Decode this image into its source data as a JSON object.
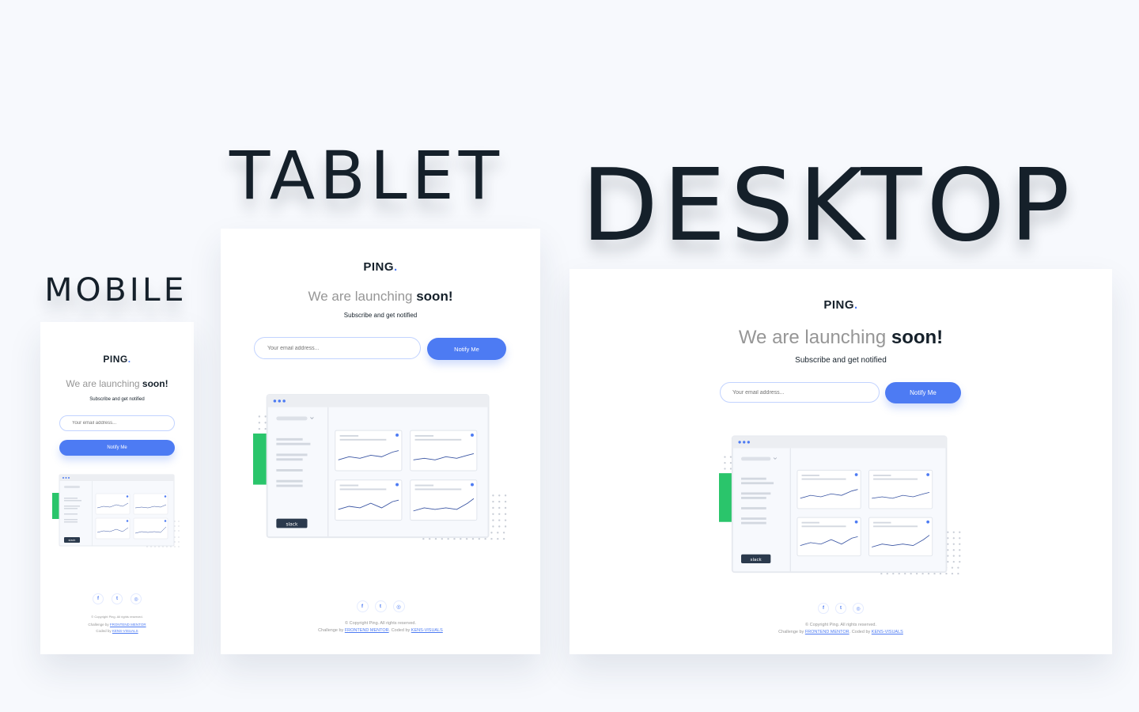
{
  "labels": {
    "mobile": "MOBILE",
    "tablet": "TABLET",
    "desktop": "DESKTOP"
  },
  "brand": {
    "logo": "PING",
    "logo_dot": "."
  },
  "hero": {
    "headline_prefix": "We are launching ",
    "headline_bold": "soon!",
    "subtitle": "Subscribe and get notified"
  },
  "form": {
    "email_placeholder": "Your email address...",
    "button_label": "Notify Me"
  },
  "illustration": {
    "slack_label": "slack"
  },
  "social": [
    {
      "name": "facebook-icon",
      "glyph": "f"
    },
    {
      "name": "twitter-icon",
      "glyph": "t"
    },
    {
      "name": "instagram-icon",
      "glyph": "◎"
    }
  ],
  "footer": {
    "copyright": "© Copyright Ping. All rights reserved.",
    "challenge_prefix": "Challenge by ",
    "challenge_link": "FRONTEND MENTOR",
    "coded_prefix": "Coded by ",
    "coded_link": "KENS-VISUALS"
  },
  "colors": {
    "accent": "#4d7bf3",
    "dark": "#15202a",
    "gray": "#969696",
    "green": "#2ac56b"
  }
}
